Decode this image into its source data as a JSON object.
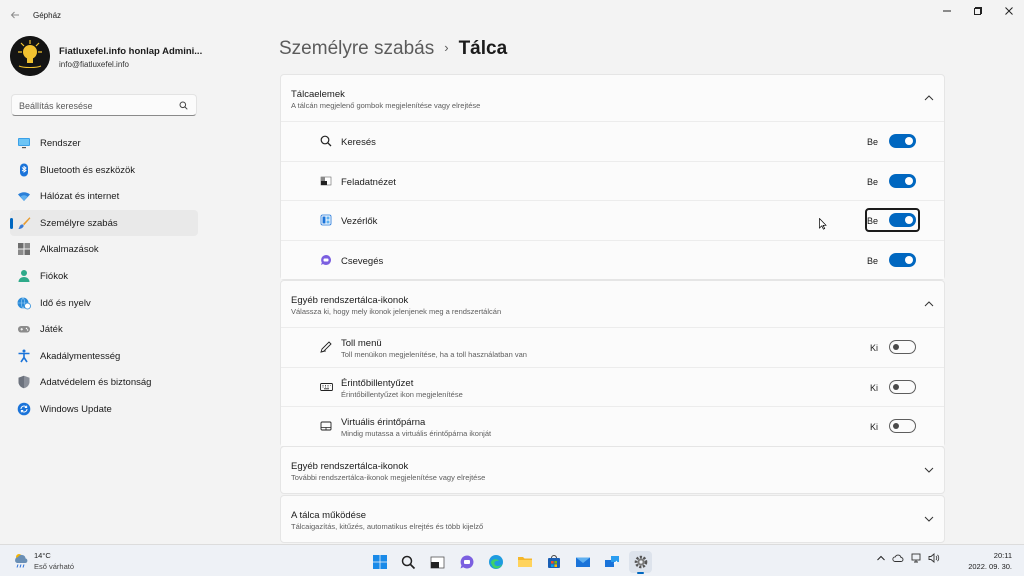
{
  "window": {
    "title": "Gépház"
  },
  "profile": {
    "name": "Fiatluxefel.info honlap Admini...",
    "email": "info@fiatluxefel.info"
  },
  "search": {
    "placeholder": "Beállítás keresése"
  },
  "sidebar": {
    "items": [
      {
        "label": "Rendszer",
        "icon": "monitor-icon"
      },
      {
        "label": "Bluetooth és eszközök",
        "icon": "bluetooth-icon"
      },
      {
        "label": "Hálózat és internet",
        "icon": "wifi-icon"
      },
      {
        "label": "Személyre szabás",
        "icon": "brush-icon",
        "active": true
      },
      {
        "label": "Alkalmazások",
        "icon": "apps-icon"
      },
      {
        "label": "Fiókok",
        "icon": "person-icon"
      },
      {
        "label": "Idő és nyelv",
        "icon": "globe-clock-icon"
      },
      {
        "label": "Játék",
        "icon": "gamepad-icon"
      },
      {
        "label": "Akadálymentesség",
        "icon": "accessibility-icon"
      },
      {
        "label": "Adatvédelem és biztonság",
        "icon": "shield-icon"
      },
      {
        "label": "Windows Update",
        "icon": "update-icon"
      }
    ]
  },
  "breadcrumb": {
    "parent": "Személyre szabás",
    "separator": "›",
    "current": "Tálca"
  },
  "sections": [
    {
      "title": "Tálcaelemek",
      "subtitle": "A tálcán megjelenő gombok megjelenítése vagy elrejtése",
      "expanded": true,
      "rows": [
        {
          "label": "Keresés",
          "state": "Be",
          "on": true,
          "icon": "search-icon"
        },
        {
          "label": "Feladatnézet",
          "state": "Be",
          "on": true,
          "icon": "task-view-icon"
        },
        {
          "label": "Vezérlők",
          "state": "Be",
          "on": true,
          "icon": "widgets-icon",
          "focused": true
        },
        {
          "label": "Csevegés",
          "state": "Be",
          "on": true,
          "icon": "chat-icon"
        }
      ]
    },
    {
      "title": "Egyéb rendszertálca-ikonok",
      "subtitle": "Válassza ki, hogy mely ikonok jelenjenek meg a rendszertálcán",
      "expanded": true,
      "rows": [
        {
          "label": "Toll menü",
          "sub": "Toll menüikon megjelenítése, ha a toll használatban van",
          "state": "Ki",
          "on": false,
          "icon": "pen-icon"
        },
        {
          "label": "Érintőbillentyűzet",
          "sub": "Érintőbillentyűzet ikon megjelenítése",
          "state": "Ki",
          "on": false,
          "icon": "keyboard-icon"
        },
        {
          "label": "Virtuális érintőpárna",
          "sub": "Mindig mutassa a virtuális érintőpárna ikonját",
          "state": "Ki",
          "on": false,
          "icon": "touchpad-icon"
        }
      ]
    },
    {
      "title": "Egyéb rendszertálca-ikonok",
      "subtitle": "További rendszertálca-ikonok megjelenítése vagy elrejtése",
      "expanded": false
    },
    {
      "title": "A tálca működése",
      "subtitle": "Tálcaigazítás, kitűzés, automatikus elrejtés és több kijelző",
      "expanded": false
    }
  ],
  "taskbar": {
    "weather_temp": "14°C",
    "weather_desc": "Eső várható",
    "time": "20:11",
    "date": "2022. 09. 30.",
    "apps": [
      "windows-start-icon",
      "search-icon",
      "task-view-icon",
      "chat-icon",
      "edge-icon",
      "file-explorer-icon",
      "store-icon",
      "mail-icon",
      "remote-icon",
      "settings-icon"
    ]
  },
  "colors": {
    "accent": "#0067c0",
    "background": "#f3f3f3",
    "card": "#fbfbfb"
  }
}
